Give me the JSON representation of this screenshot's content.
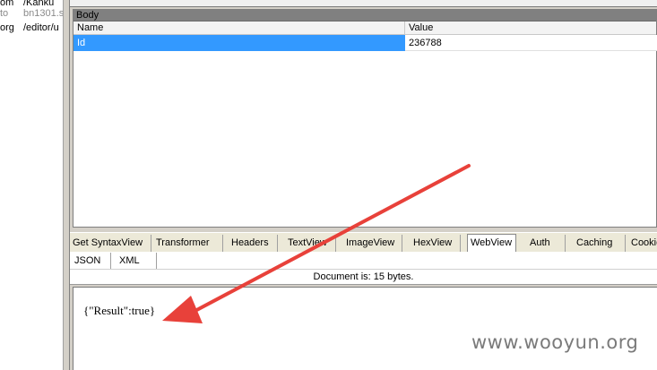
{
  "session_list": {
    "rows": [
      {
        "col1": "om",
        "col2": "/Kanku"
      },
      {
        "col1": "to",
        "col2": "bn1301.s"
      },
      {
        "col1": "org",
        "col2": "/editor/u"
      }
    ]
  },
  "body_panel": {
    "title": "Body",
    "columns": [
      "Name",
      "Value"
    ],
    "rows": [
      {
        "name": "Id",
        "value": "236788"
      }
    ]
  },
  "inspector_tabs": [
    {
      "label": "Get SyntaxView",
      "active": false
    },
    {
      "label": "Transformer",
      "active": false
    },
    {
      "label": "Headers",
      "active": false
    },
    {
      "label": "TextView",
      "active": false
    },
    {
      "label": "ImageView",
      "active": false
    },
    {
      "label": "HexView",
      "active": false
    },
    {
      "label": "WebView",
      "active": true
    },
    {
      "label": "Auth",
      "active": false
    },
    {
      "label": "Caching",
      "active": false
    },
    {
      "label": "Cookie",
      "active": false
    }
  ],
  "sub_tabs": [
    {
      "label": "JSON"
    },
    {
      "label": "XML"
    }
  ],
  "status": "Document is: 15 bytes.",
  "web_view_content": "{\"Result\":true}",
  "watermark": "www.wooyun.org",
  "colors": {
    "selection": "#3399ff",
    "annotation_arrow": "#e8413a",
    "panel_title": "#808080"
  },
  "icons": [
    "red-arrow-annotation"
  ]
}
